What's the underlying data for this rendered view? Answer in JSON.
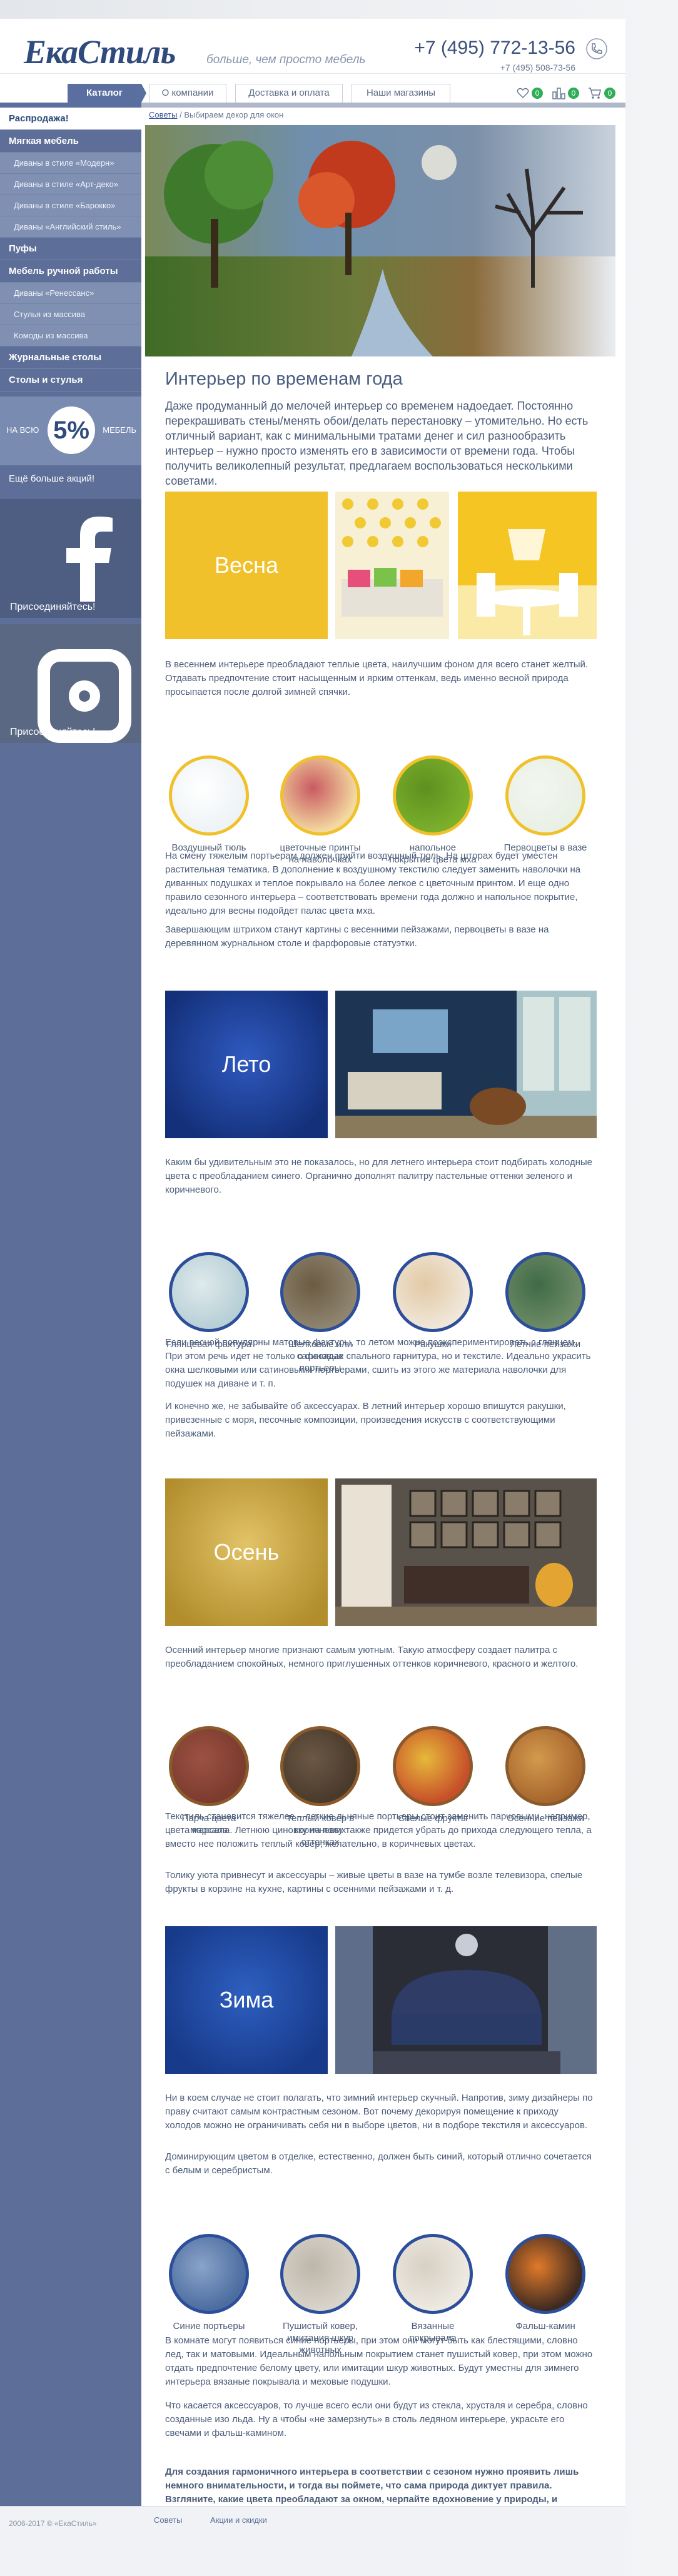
{
  "header": {
    "logo": "ЕкаСтиль",
    "tagline": "больше, чем просто мебель",
    "phone_main": "+7 (495) 772-13-56",
    "phone_second": "+7 (495) 508-73-56"
  },
  "nav": {
    "catalog": "Каталог",
    "links": [
      "О компании",
      "Доставка и оплата",
      "Наши магазины"
    ],
    "favorites_count": "0",
    "compare_count": "0",
    "cart_count": "0"
  },
  "sidebar": {
    "items": [
      {
        "label": "Распродажа!",
        "type": "active"
      },
      {
        "label": "Мягкая мебель",
        "type": "main"
      },
      {
        "label": "Диваны в стиле «Модерн»",
        "type": "sub"
      },
      {
        "label": "Диваны в стиле «Арт-деко»",
        "type": "sub"
      },
      {
        "label": "Диваны в стиле «Барокко»",
        "type": "sub"
      },
      {
        "label": "Диваны «Английский стиль»",
        "type": "sub"
      },
      {
        "label": "Пуфы",
        "type": "main"
      },
      {
        "label": "Мебель ручной работы",
        "type": "main"
      },
      {
        "label": "Диваны «Ренессанс»",
        "type": "sub"
      },
      {
        "label": "Стулья из массива",
        "type": "sub"
      },
      {
        "label": "Комоды из массива",
        "type": "sub"
      },
      {
        "label": "Журнальные столы",
        "type": "main"
      },
      {
        "label": "Столы и стулья",
        "type": "main"
      }
    ],
    "promo_left": "НА ВСЮ",
    "promo_value": "5%",
    "promo_right": "МЕБЕЛЬ",
    "more_promos": "Ещё больше акций!",
    "facebook_caption": "Присоединяйтесь!",
    "instagram_caption": "Присоединяйтесь!"
  },
  "breadcrumb": {
    "root": "Советы",
    "current": "Выбираем декор для окон"
  },
  "article": {
    "title": "Интерьер по временам года",
    "lead": "Даже продуманный до мелочей интерьер со временем надоедает. Постоянно перекрашивать стены/менять обои/делать перестановку – утомительно. Но есть отличный вариант, как с минимальными тратами денег и сил разнообразить интерьер – нужно просто изменять его в зависимости от времени года. Чтобы получить великолепный результат, предлагаем воспользоваться несколькими советами.",
    "spring": {
      "title": "Весна",
      "p1": "В весеннем интерьере преобладают теплые цвета, наилучшим фоном для всего станет желтый. Отдавать предпочтение стоит насыщенным и ярким оттенкам, ведь именно весной природа просыпается после долгой зимней спячки.",
      "circles": [
        "Воздушный тюль",
        "цветочные принты на наволочках",
        "напольное покрытие цвета мха",
        "Первоцветы в вазе"
      ],
      "p2": "На смену тяжелым портьерам должен прийти воздушный тюль. На шторах будет уместен растительная тематика. В дополнение к воздушному текстилю следует заменить наволочки на диванных подушках и теплое покрывало на более легкое с цветочным принтом. И еще одно правило сезонного интерьера – соответствовать времени года должно и напольное покрытие, идеально для весны подойдет палас цвета мха.",
      "p3": "Завершающим штрихом станут картины с весенними пейзажами, первоцветы в вазе на деревянном журнальном столе и фарфоровые статуэтки."
    },
    "summer": {
      "title": "Лето",
      "p1": "Каким бы удивительным это не показалось, но для летнего интерьера стоит подбирать холодные цвета с преобладанием синего. Органично дополнят палитру пастельные оттенки зеленого и коричневого.",
      "circles": [
        "Глянцевая фактура",
        "Шелковые или сатиновые портьеры",
        "Ракушки",
        "Летние пейзажи"
      ],
      "p2": "Если весной популярны матовые фактуры, то летом можно поэкспериментировать с глянцем. При этом речь идет не только о фасадах спального гарнитура, но и текстиле. Идеально украсить окна шелковыми или сатиновыми портьерами, сшить из этого же материала наволочки для подушек на диване и т. п.",
      "p3": "И конечно же, не забывайте об аксессуарах. В летний интерьер хорошо впишутся ракушки, привезенные с моря, песочные композиции, произведения искусств с соответствующими пейзажами."
    },
    "autumn": {
      "title": "Осень",
      "p1": "Осенний интерьер многие признают самым уютным. Такую атмосферу создает палитра с преобладанием спокойных, немного приглушенных оттенков коричневого, красного и желтого.",
      "circles": [
        "Парча цвета марсала",
        "Теплый ковер в коричневых оттенках",
        "Спелые фрукты",
        "Осенние пейзажи"
      ],
      "p2": "Текстиль становится тяжелее – легкие льняные портьеры стоит заменить парчовыми, например, цвета марсала. Летнюю циновку на полу также придется убрать до прихода следующего тепла, а вместо нее положить теплый ковер, желательно, в коричневых цветах.",
      "p3": "Толику уюта привнесут и аксессуары – живые цветы в вазе на тумбе возле телевизора, спелые фрукты в корзине на кухне, картины с осенними пейзажами и т. д."
    },
    "winter": {
      "title": "Зима",
      "p1": "Ни в коем случае не стоит полагать, что зимний интерьер скучный. Напротив, зиму дизайнеры по праву считают самым контрастным сезоном. Вот почему декорируя помещение к приходу холодов можно не ограничивать себя ни в выборе цветов, ни в подборе текстиля и аксессуаров.",
      "p2": "Доминирующим цветом в отделке, естественно, должен быть синий, который отлично сочетается с белым и серебристым.",
      "circles": [
        "Синие портьеры",
        "Пушистый ковер, имитация шкур животных",
        "Вязанные покрывала",
        "Фальш-камин"
      ],
      "p3": "В комнате могут появиться синие портьеры, при этом они могут быть как блестящими, словно лед, так и матовыми. Идеальным напольным покрытием станет пушистый ковер, при этом можно отдать предпочтение белому цвету, или имитации шкур животных. Будут уместны для зимнего интерьера вязаные покрывала и меховые подушки.",
      "p4": "Что касается аксессуаров, то лучше всего если они будут из стекла, хрусталя и серебра, словно созданные изо льда. Ну а чтобы «не замерзнуть» в столь ледяном интерьере, украсьте его свечами и фальш-камином."
    },
    "conclusion": "Для создания гармоничного интерьера в соответствии с сезоном нужно проявить лишь немного внимательности, и тогда вы поймете, что сама природа диктует правила. Взгляните, какие цвета преобладают за окном, черпайте вдохновение у природы, и творите, отталкиваясь от этого!"
  },
  "footer": {
    "copyright": "2006-2017 © «ЕкаСтиль»",
    "links": [
      "Советы",
      "Акции и скидки"
    ]
  },
  "colors": {
    "brand_blue": "#2f4b7c",
    "sidebar": "#5d6f98",
    "badge_green": "#2fae57",
    "spring_yellow": "#f0c12a",
    "summer_blue": "#1e3f8f",
    "autumn_gold": "#c9a53a",
    "winter_blue": "#1d4ea0"
  }
}
